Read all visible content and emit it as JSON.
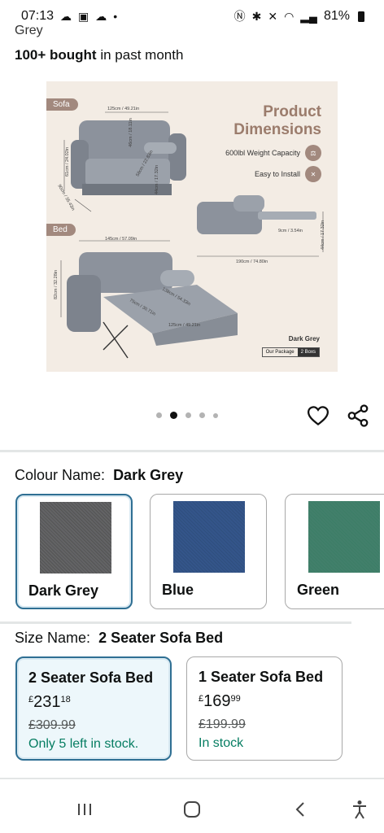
{
  "status_bar": {
    "time": "07:13",
    "battery": "81%"
  },
  "header": {
    "variant_cut": "Grey",
    "bought_bold": "100+ bought",
    "bought_rest": "in past month"
  },
  "product_image": {
    "title_line1": "Product",
    "title_line2": "Dimensions",
    "label_sofa": "Sofa",
    "label_bed": "Bed",
    "weight_text": "600lbl Weight Capacity",
    "install_text": "Easy to Install",
    "brand": "Dark Grey",
    "package_label": "Our Package",
    "package_count": "2 Boxs",
    "dims": {
      "sofa_width": "125cm / 49.21in",
      "sofa_height": "61cm / 24.02in",
      "sofa_depth": "90cm / 35.43in",
      "seat_height": "46cm / 18.11in",
      "seat_depth": "58cm / 22.83in",
      "back": "44cm / 17.32in",
      "bed_width": "145cm / 57.09in",
      "bed_height": "82cm / 32.28in",
      "bed_length": "138cm / 54.33in",
      "bed_mid": "75cm / 30.71in",
      "bed_foot": "125cm / 49.21in",
      "bed_total": "190cm / 74.80in",
      "side_gap": "9cm / 3.54in",
      "side_height": "44cm / 17.32in"
    }
  },
  "carousel": {
    "count": 5,
    "active_index": 1
  },
  "colour": {
    "label": "Colour Name:",
    "selected": "Dark Grey",
    "options": [
      {
        "name": "Dark Grey",
        "color": "#5d5e62"
      },
      {
        "name": "Blue",
        "color": "#2f4f7e"
      },
      {
        "name": "Green",
        "color": "#3c7e66"
      }
    ]
  },
  "size": {
    "label": "Size Name:",
    "selected": "2 Seater Sofa Bed",
    "options": [
      {
        "name": "2 Seater Sofa Bed",
        "currency": "£",
        "whole": "231",
        "fraction": "18",
        "was": "£309.99",
        "stock": "Only 5 left in stock."
      },
      {
        "name": "1 Seater Sofa Bed",
        "currency": "£",
        "whole": "169",
        "fraction": "99",
        "was": "£199.99",
        "stock": "In stock"
      }
    ]
  },
  "colors": {
    "accent": "#2f6f93",
    "stock_green": "#067d62"
  }
}
